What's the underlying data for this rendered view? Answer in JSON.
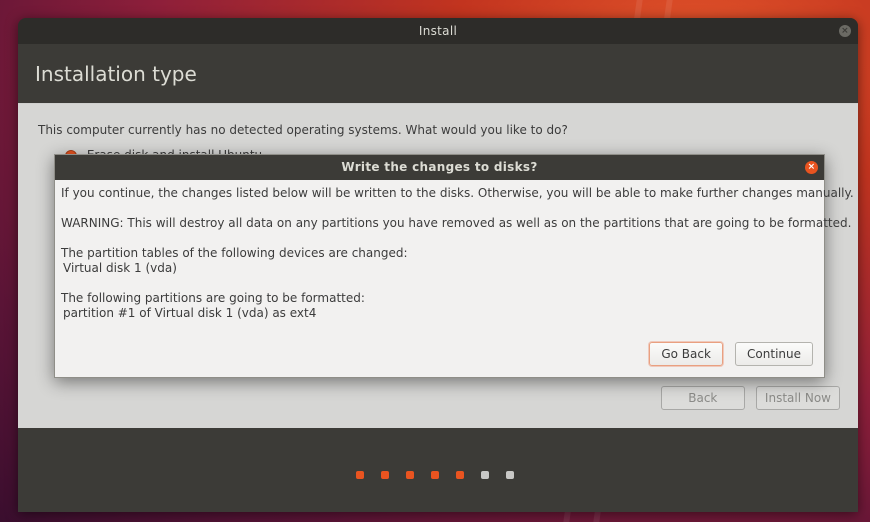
{
  "window": {
    "title": "Install"
  },
  "header": {
    "title": "Installation type"
  },
  "content": {
    "question": "This computer currently has no detected operating systems. What would you like to do?",
    "option_label": "Erase disk and install Ubuntu"
  },
  "bottom_buttons": {
    "back": "Back",
    "install_now": "Install Now"
  },
  "progress_dots": {
    "total": 7,
    "done": 5,
    "done_color": "#e95420",
    "pending_color": "#c8c8c6"
  },
  "dialog": {
    "title": "Write the changes to disks?",
    "intro": "If you continue, the changes listed below will be written to the disks. Otherwise, you will be able to make further changes manually.",
    "warning": "WARNING: This will destroy all data on any partitions you have removed as well as on the partitions that are going to be formatted.",
    "tables_heading": "The partition tables of the following devices are changed:",
    "tables_item": "Virtual disk 1 (vda)",
    "format_heading": "The following partitions are going to be formatted:",
    "format_item": "partition #1 of Virtual disk 1 (vda) as ext4",
    "go_back": "Go Back",
    "continue": "Continue"
  },
  "colors": {
    "accent": "#e95420",
    "chrome": "#3c3b37",
    "content_bg": "#d6d6d4"
  }
}
